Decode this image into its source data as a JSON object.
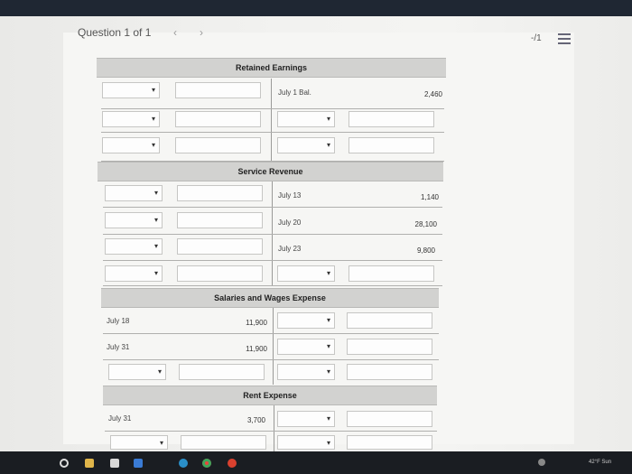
{
  "header": {
    "question_label": "Question 1 of 1",
    "prev_icon": "chevron-left-icon",
    "next_icon": "chevron-right-icon",
    "score": "-/1",
    "menu_icon": "list-icon"
  },
  "accounts": [
    {
      "title": "Retained Earnings",
      "rows": [
        {
          "right_label": "July 1 Bal.",
          "right_amount": "2,460"
        }
      ]
    },
    {
      "title": "Service Revenue",
      "rows": [
        {
          "right_label": "July 13",
          "right_amount": "1,140"
        },
        {
          "right_label": "July 20",
          "right_amount": "28,100"
        },
        {
          "right_label": "July 23",
          "right_amount": "9,800"
        }
      ]
    },
    {
      "title": "Salaries and Wages Expense",
      "rows": [
        {
          "left_label": "July 18",
          "left_amount": "11,900"
        },
        {
          "left_label": "July 31",
          "left_amount": "11,900"
        }
      ]
    },
    {
      "title": "Rent Expense",
      "rows": [
        {
          "left_label": "July 31",
          "left_amount": "3,700"
        }
      ]
    }
  ],
  "taskbar": {
    "weather": "42°F Sun",
    "icons": [
      "search-icon",
      "file-explorer-icon",
      "store-icon",
      "mail-icon",
      "edge-icon",
      "chrome-icon",
      "photos-icon"
    ]
  }
}
